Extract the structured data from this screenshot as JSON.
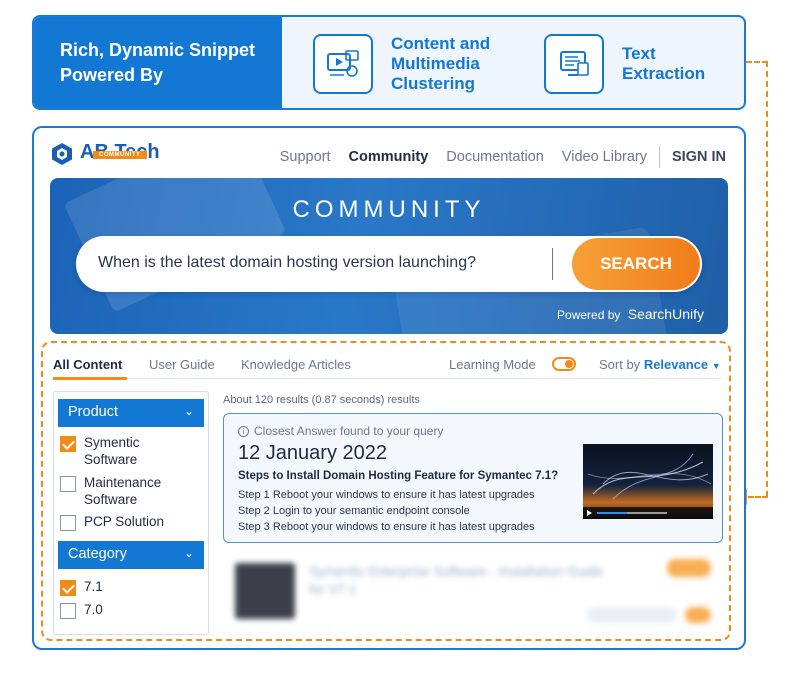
{
  "banner": {
    "title": "Rich, Dynamic Snippet Powered By",
    "features": [
      {
        "label": "Content and Multimedia Clustering",
        "icon": "multimedia-icon"
      },
      {
        "label": "Text Extraction",
        "icon": "text-extraction-icon"
      }
    ]
  },
  "brand": {
    "name": "AB Tech",
    "badge": "COMMUNITY"
  },
  "nav": {
    "items": [
      "Support",
      "Community",
      "Documentation",
      "Video Library"
    ],
    "active": "Community",
    "signin": "SIGN IN"
  },
  "hero": {
    "title": "COMMUNITY",
    "query": "When is the latest domain hosting version launching?",
    "search_label": "SEARCH",
    "powered_by_prefix": "Powered by",
    "powered_by_brand": "SearchUnify"
  },
  "tabs": {
    "items": [
      "All Content",
      "User Guide",
      "Knowledge Articles"
    ],
    "active": "All Content",
    "learning_mode": "Learning Mode",
    "learning_mode_on": true,
    "sort_prefix": "Sort by",
    "sort_value": "Relevance"
  },
  "filters": {
    "product": {
      "title": "Product",
      "options": [
        {
          "label": "Symentic Software",
          "checked": true
        },
        {
          "label": "Maintenance Software",
          "checked": false
        },
        {
          "label": "PCP Solution",
          "checked": false
        }
      ]
    },
    "category": {
      "title": "Category",
      "options": [
        {
          "label": "7.1",
          "checked": true
        },
        {
          "label": "7.0",
          "checked": false
        }
      ]
    }
  },
  "results": {
    "count_text": "About 120 results (0.87 seconds) results",
    "answer": {
      "hint": "Closest Answer found to your query",
      "date": "12 January 2022",
      "title": "Steps to Install Domain Hosting Feature for Symantec 7.1?",
      "steps": [
        "Step 1 Reboot your windows to ensure it has latest upgrades",
        "Step 2 Login to your semantic endpoint console",
        "Step 3 Reboot your windows to ensure it has latest upgrades"
      ]
    },
    "blurred_title": "Symentic Enterprise Software - Installation Guide for V7.1"
  },
  "colors": {
    "primary": "#1378d3",
    "accent": "#f28a17",
    "text": "#1f2a44"
  }
}
